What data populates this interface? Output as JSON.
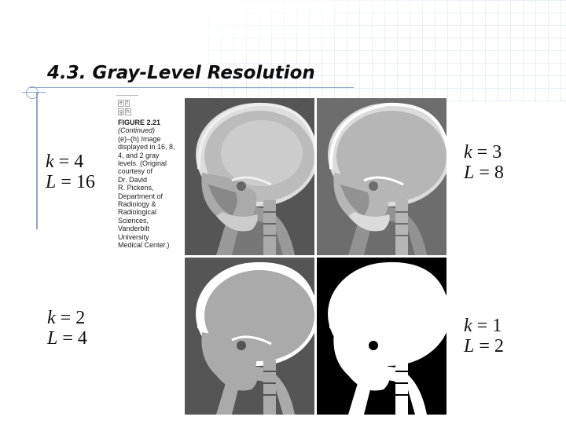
{
  "slide": {
    "title": "4.3. Gray-Level Resolution"
  },
  "figure": {
    "tiles": [
      "e",
      "f",
      "g",
      "h"
    ],
    "label": "FIGURE 2.21",
    "continued": "(Continued)",
    "caption_lines": [
      "(e)–(h) Image",
      "displayed in 16, 8,",
      "4, and 2 gray",
      "levels. (Original",
      "courtesy of",
      "Dr. David",
      "R. Pickens,",
      "Department of",
      "Radiology &",
      "Radiological",
      "Sciences,",
      "Vanderbilt",
      "University",
      "Medical Center.)"
    ]
  },
  "labels": {
    "top_left": {
      "k": "k",
      "k_val": " = 4",
      "L": "L",
      "L_val": " = 16"
    },
    "top_right": {
      "k": "k",
      "k_val": " = 3",
      "L": "L",
      "L_val": " = 8"
    },
    "bottom_left": {
      "k": "k",
      "k_val": " = 2",
      "L": "L",
      "L_val": " = 4"
    },
    "bottom_right": {
      "k": "k",
      "k_val": " = 1",
      "L": "L",
      "L_val": " = 2"
    }
  },
  "panels": [
    {
      "name": "skull-16-levels",
      "gray_levels": 16
    },
    {
      "name": "skull-8-levels",
      "gray_levels": 8
    },
    {
      "name": "skull-4-levels",
      "gray_levels": 4
    },
    {
      "name": "skull-2-levels",
      "gray_levels": 2
    }
  ],
  "colors": {
    "accent_line": "#8fa7c8",
    "title_text": "#0d0d0d"
  }
}
